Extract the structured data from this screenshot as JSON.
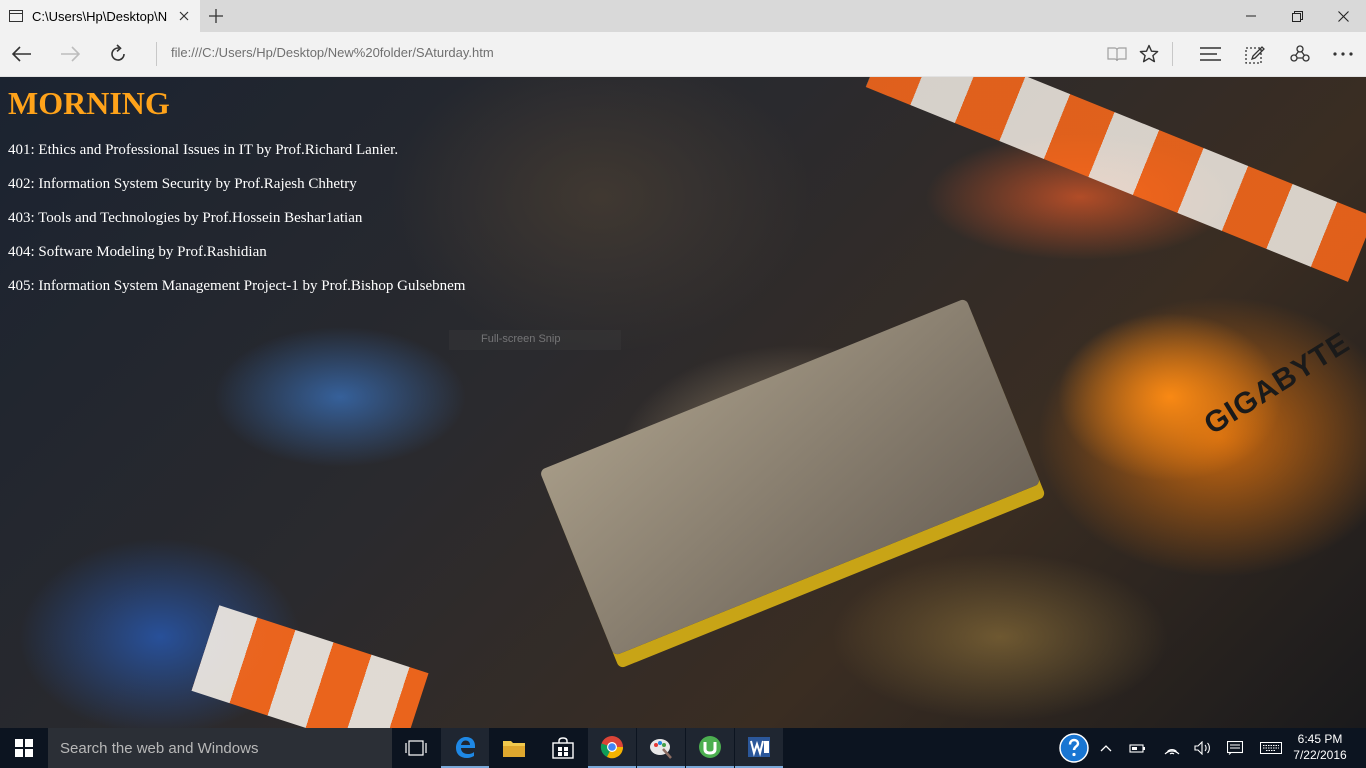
{
  "browser": {
    "tab": {
      "title": "C:\\Users\\Hp\\Desktop\\N",
      "favicon": "page-icon"
    },
    "address_url": "file:///C:/Users/Hp/Desktop/New%20folder/SAturday.htm",
    "toolbar_icons": [
      "back-icon",
      "forward-icon",
      "refresh-icon",
      "reading-view-icon",
      "favorites-star-icon",
      "hub-icon",
      "web-note-icon",
      "share-icon",
      "more-icon"
    ],
    "window_controls": [
      "minimize-icon",
      "restore-icon",
      "close-icon"
    ]
  },
  "page": {
    "heading": "MORNING",
    "heading_color": "#ffa31a",
    "courses": [
      "401: Ethics and Professional Issues in IT by Prof.Richard Lanier.",
      "402: Information System Security by Prof.Rajesh Chhetry",
      "403: Tools and Technologies by Prof.Hossein Beshar1atian",
      "404: Software Modeling by Prof.Rashidian",
      "405: Information System Management Project-1 by Prof.Bishop Gulsebnem"
    ],
    "overlay_hint": "Full-screen Snip",
    "background_brand": "GIGABYTE"
  },
  "taskbar": {
    "search_placeholder": "Search the web and Windows",
    "apps": [
      "task-view-icon",
      "edge-icon",
      "file-explorer-icon",
      "store-icon",
      "chrome-icon",
      "paint-icon",
      "utorrent-icon",
      "word-icon"
    ],
    "tray": [
      "help-icon",
      "show-hidden-icon",
      "battery-icon",
      "wifi-icon",
      "volume-icon",
      "action-center-icon",
      "keyboard-icon"
    ],
    "time": "6:45 PM",
    "date": "7/22/2016"
  }
}
